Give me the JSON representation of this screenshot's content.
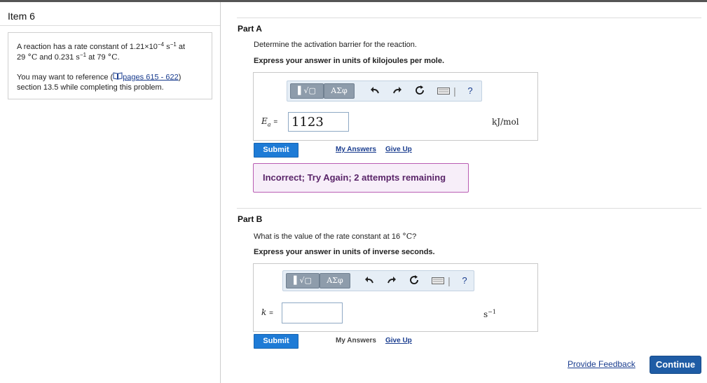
{
  "item": {
    "title": "Item 6"
  },
  "problem": {
    "line1_pre": "A reaction has a rate constant of 1.21×10",
    "line1_exp": "−4",
    "line1_unit": "s",
    "line1_unit_exp": "−1",
    "line1_post": "at",
    "line2_temp1": "29",
    "line2_degc": "°C",
    "line2_mid": "and 0.231",
    "line2_unit": "s",
    "line2_unit_exp": "−1",
    "line2_at": "at 79",
    "line2_degc2": "°C",
    "line2_end": ".",
    "ref_pre": "You may want to reference (",
    "ref_link": "pages 615 - 622",
    "ref_post": ")",
    "ref_line2": "section 13.5 while completing this problem."
  },
  "part_a": {
    "title": "Part A",
    "question": "Determine the activation barrier for the reaction.",
    "instruction": "Express your answer in units of kilojoules per mole.",
    "var_label": "E",
    "var_sub": "a",
    "equals": "=",
    "answer_value": "1123",
    "unit": "kJ/mol",
    "submit_label": "Submit",
    "my_answers_label": "My Answers",
    "give_up_label": "Give Up",
    "feedback": "Incorrect; Try Again; 2 attempts remaining"
  },
  "part_b": {
    "title": "Part B",
    "question": "What is the value of the rate constant at 16",
    "question_unit": "°C",
    "question_end": "?",
    "instruction": "Express your answer in units of inverse seconds.",
    "var_label": "k",
    "equals": "=",
    "answer_value": "",
    "unit": "s",
    "unit_exp": "−1",
    "submit_label": "Submit",
    "my_answers_label": "My Answers",
    "give_up_label": "Give Up"
  },
  "toolbar": {
    "templates_label": "▌√▢",
    "symbols_label": "ΑΣφ",
    "undo_icon": "undo-icon",
    "redo_icon": "redo-icon",
    "reset_icon": "reset-icon",
    "keyboard_icon": "keyboard-icon",
    "help_label": "?"
  },
  "footer": {
    "provide_feedback": "Provide Feedback",
    "continue_label": "Continue"
  },
  "colors": {
    "accent": "#1e7bd6",
    "continue": "#1f5ca5",
    "feedback_border": "#b95db3",
    "feedback_bg": "#f7eef9",
    "feedback_text": "#5a2569"
  }
}
